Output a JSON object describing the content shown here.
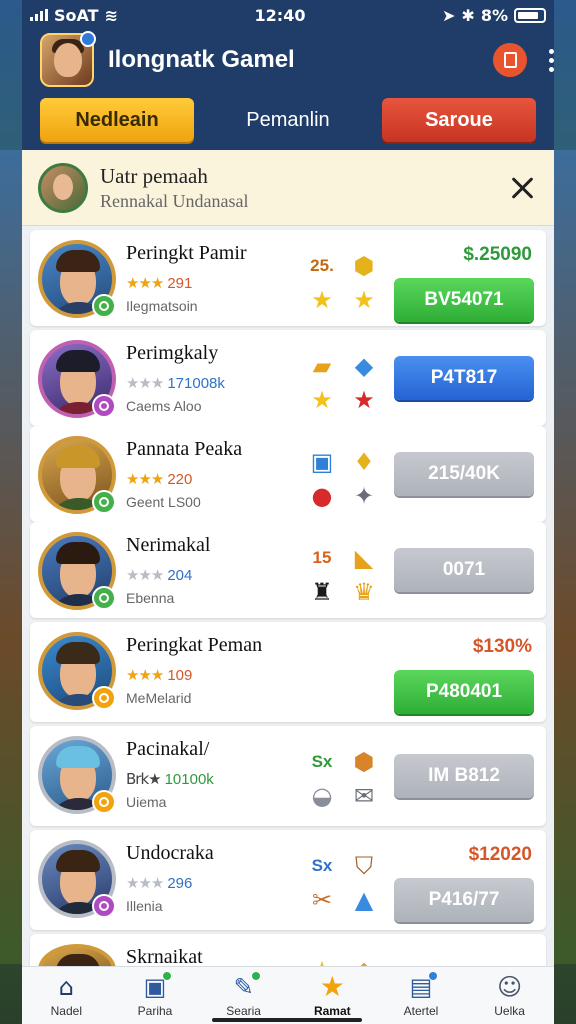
{
  "status": {
    "carrier": "SoAT",
    "time": "12:40",
    "battery": "8%"
  },
  "header": {
    "title": "Ilongnatk Gamel"
  },
  "tabs": [
    {
      "label": "Nedleain"
    },
    {
      "label": "Pemanlin"
    },
    {
      "label": "Saroue"
    }
  ],
  "notice": {
    "title": "Uatr pemaah",
    "subtitle": "Rennakal Undanasal"
  },
  "rows": [
    {
      "name": "Peringkt Pamir",
      "stars": "★★★",
      "score": "291",
      "sub": "Ilegmatsoin",
      "price": "$.25090",
      "icon_tl": "25.",
      "icon_tr": "⬢",
      "icon_bl": "★",
      "icon_br": "★",
      "button": "BV54071"
    },
    {
      "name": "Perimgkaly",
      "stars": "★★★",
      "score": "171008k",
      "sub": "Caems Aloo",
      "price": "",
      "icon_tl": "▰",
      "icon_tr": "◆",
      "icon_bl": "★",
      "icon_br": "★",
      "button": "P4T817"
    },
    {
      "name": "Pannata Peaka",
      "stars": "★★★",
      "score": "220",
      "sub": "Geent LS00",
      "price": "",
      "icon_tl": "▣",
      "icon_tr": "♦",
      "icon_bl": "●",
      "icon_br": "✦",
      "button": "215/40K"
    },
    {
      "name": "Nerimakal",
      "stars": "★★★",
      "score": "204",
      "sub": "Ebenna",
      "price": "",
      "icon_tl": "15",
      "icon_tr": "◣",
      "icon_bl": "♜",
      "icon_br": "♛",
      "button": "0071"
    },
    {
      "name": "Peringkat Peman",
      "stars": "★★★",
      "score": "109",
      "sub": "MeMelarid",
      "price": "$130%",
      "icon_tl": "",
      "icon_tr": "",
      "icon_bl": "",
      "icon_br": "",
      "button": "P480401"
    },
    {
      "name": "Pacinakal/",
      "stars": "Brk★",
      "score": "10100k",
      "sub": "Uiema",
      "price": "",
      "icon_tl": "Sx",
      "icon_tr": "⬢",
      "icon_bl": "◒",
      "icon_br": "✉",
      "button": "IM B812"
    },
    {
      "name": "Undocraka",
      "stars": "★★★",
      "score": "296",
      "sub": "Illenia",
      "price": "$12020",
      "icon_tl": "Sx",
      "icon_tr": "⛉",
      "icon_bl": "✂",
      "icon_br": "▲",
      "button": "P416/77"
    },
    {
      "name": "Skrnaikat",
      "stars": "",
      "score": "",
      "sub": "",
      "price": "",
      "icon_tl": "★",
      "icon_tr": "◆",
      "icon_bl": "",
      "icon_br": "",
      "button": ""
    }
  ],
  "nav": [
    {
      "label": "Nadel",
      "icon": "home-icon"
    },
    {
      "label": "Pariha",
      "icon": "cup-icon"
    },
    {
      "label": "Searia",
      "icon": "edit-icon"
    },
    {
      "label": "Ramat",
      "icon": "star-icon"
    },
    {
      "label": "Atertel",
      "icon": "document-icon"
    },
    {
      "label": "Uelka",
      "icon": "user-icon"
    }
  ],
  "colors": {
    "header_bg": "#1f3d68",
    "green": "#2fae36",
    "blue": "#2464d4",
    "gray": "#aeb2ba",
    "red": "#c73423",
    "yellow": "#f0a30f",
    "price_green": "#2f9a3a",
    "price_orange": "#d4572a"
  }
}
